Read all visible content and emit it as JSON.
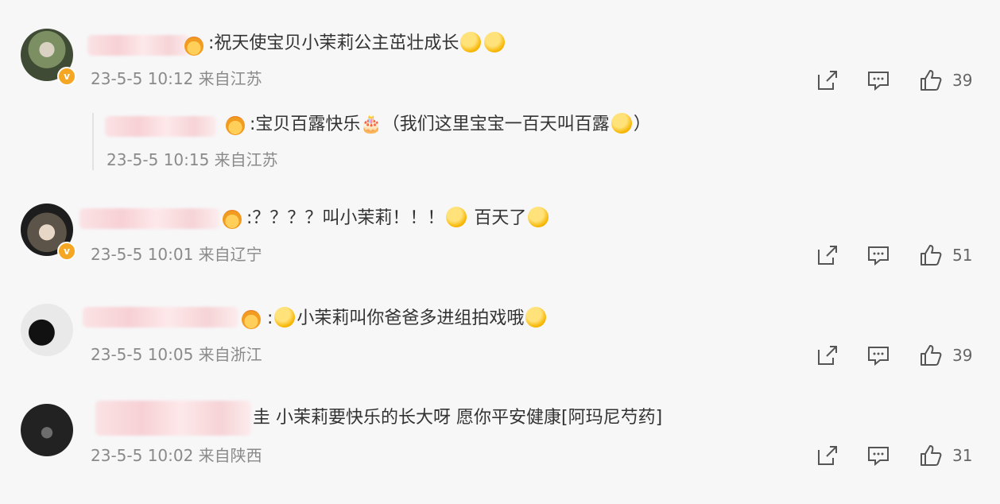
{
  "comments": [
    {
      "text": ":祝天使宝贝小茉莉公主茁壮成长",
      "meta": "23-5-5 10:12 来自江苏",
      "likes": "39",
      "reply": {
        "text": ":宝贝百露快乐🎂（我们这里宝宝一百天叫百露",
        "text_end": "）",
        "meta": "23-5-5 10:15 来自江苏"
      }
    },
    {
      "text": ":？？？？叫小茉莉！！！",
      "text2": "百天了",
      "meta": "23-5-5 10:01 来自辽宁",
      "likes": "51"
    },
    {
      "text": ":",
      "text2": "小茉莉叫你爸爸多进组拍戏哦",
      "meta": "23-5-5 10:05 来自浙江",
      "likes": "39"
    },
    {
      "text": "圭 小茉莉要快乐的长大呀 愿你平安健康[阿玛尼芍药]",
      "meta": "23-5-5 10:02 来自陕西",
      "likes": "31"
    }
  ],
  "icons": [
    "share-icon",
    "comment-icon",
    "like-icon",
    "verified-badge-icon",
    "emoji-icon"
  ],
  "colors": {
    "background": "#f7f7f8",
    "meta": "#8a8a8a",
    "verified": "#f5a623"
  }
}
